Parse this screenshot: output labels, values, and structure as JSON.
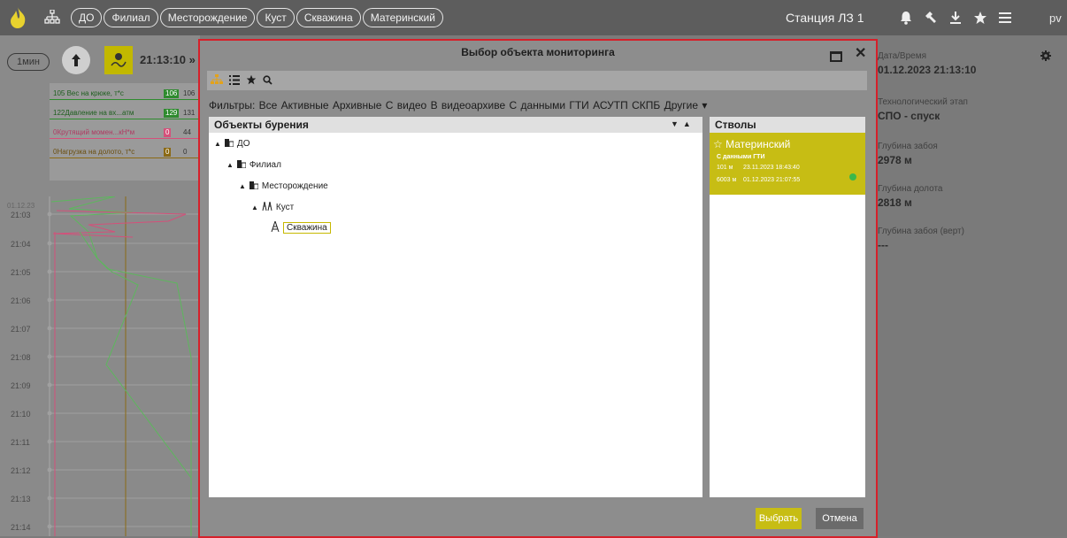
{
  "topbar": {
    "breadcrumbs": [
      "ДО",
      "Филиал",
      "Месторождение",
      "Куст",
      "Скважина",
      "Материнский"
    ],
    "station": "Станция ЛЗ 1",
    "user": "pv",
    "icons": [
      "flame-logo-icon",
      "hierarchy-icon",
      "bell-icon",
      "hammer-icon",
      "download-icon",
      "star-icon",
      "menu-icon"
    ]
  },
  "left": {
    "interval": "1мин",
    "current_time": "21:13:10 »",
    "params": [
      {
        "name": "105  Вес на крюке, т*с",
        "value": "106",
        "value2": "106",
        "color": "#2e8b2e"
      },
      {
        "name": "122Давление на вх...атм",
        "value": "129",
        "value2": "131",
        "color": "#2e8b2e"
      },
      {
        "name": "0Крутящий момен...кН*м",
        "value": "0",
        "value2": "44",
        "color": "#d4507a"
      },
      {
        "name": "0Нагрузка на долото, т*с",
        "value": "0",
        "value2": "0",
        "color": "#8b6914"
      }
    ],
    "date": "01.12.23",
    "times": [
      "21:03",
      "21:04",
      "21:05",
      "21:06",
      "21:07",
      "21:08",
      "21:09",
      "21:10",
      "21:11",
      "21:12",
      "21:13",
      "21:14"
    ]
  },
  "right": {
    "datetime_label": "Дата/Время",
    "datetime_value": "01.12.2023 21:13:10",
    "stage_label": "Технологический этап",
    "stage_value": "СПО - спуск",
    "depth_label": "Глубина забоя",
    "depth_value": "2978 м",
    "bit_label": "Глубина долота",
    "bit_value": "2818 м",
    "vert_label": "Глубина забоя (верт)",
    "vert_value": "---"
  },
  "modal": {
    "title": "Выбор объекта мониторинга",
    "filters_label": "Фильтры:",
    "filters": [
      "Все",
      "Активные",
      "Архивные",
      "С видео",
      "В видеоархиве",
      "С данными ГТИ",
      "АСУТП",
      "СКПБ",
      "Другие ▾"
    ],
    "tree_title": "Объекты бурения",
    "tree": [
      {
        "label": "ДО",
        "level": 0
      },
      {
        "label": "Филиал",
        "level": 1
      },
      {
        "label": "Месторождение",
        "level": 2
      },
      {
        "label": "Куст",
        "level": 3
      },
      {
        "label": "Скважина",
        "level": 4
      }
    ],
    "trunks_title": "Стволы",
    "trunk": {
      "name": "Материнский",
      "sub": "С данными ГТИ",
      "row1_depth": "101 м",
      "row1_date": "23.11.2023 18:43:40",
      "row2_depth": "6003 м",
      "row2_date": "01.12.2023 21:07:55",
      "status_color": "#3bb84a"
    },
    "ok_label": "Выбрать",
    "cancel_label": "Отмена"
  },
  "colors": {
    "accent": "#c7bd14",
    "modal_border": "#d6202a",
    "topbar": "#5d5d5d"
  }
}
